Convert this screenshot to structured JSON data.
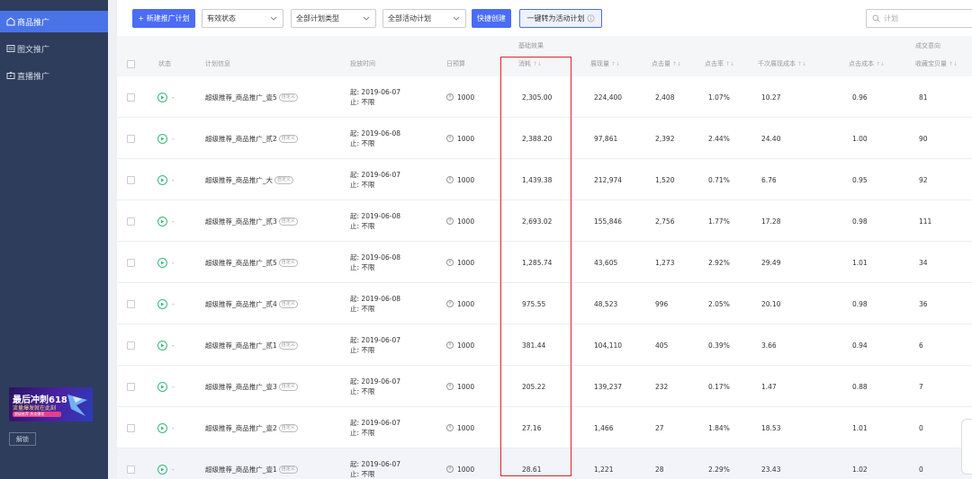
{
  "sidebar": {
    "items": [
      {
        "label": "商品推广",
        "icon": "bag-icon",
        "active": true
      },
      {
        "label": "图文推广",
        "icon": "image-icon",
        "active": false
      },
      {
        "label": "直播推广",
        "icon": "tv-icon",
        "active": false
      }
    ],
    "banner": {
      "title": "最后冲刺618",
      "subtitle": "流量爆发就在此刻",
      "tag": "超级推荐 热卖爆发"
    },
    "unlock_label": "解锁"
  },
  "toolbar": {
    "new_plan_label": "+ 新建推广计划",
    "status_select": "有效状态",
    "type_select": "全部计划类型",
    "activity_select": "全部活动计划",
    "quick_create_label": "快捷创建",
    "convert_label": "一键转为活动计划",
    "search_placeholder": "计划"
  },
  "table": {
    "groups": {
      "basic": "基础效果",
      "conversion": "成交意向"
    },
    "headers": {
      "status": "状态",
      "plan_info": "计划信息",
      "time": "投放时间",
      "budget": "日预算",
      "cost": "消耗",
      "impressions": "展现量",
      "clicks": "点击量",
      "ctr": "点击率",
      "cpm": "千次展现成本",
      "cpc": "点击成本",
      "fav": "收藏宝贝量"
    },
    "sort_glyph": "↑↓",
    "tag_label": "自定义",
    "start_prefix": "起: ",
    "end_label": "止: 不限",
    "status_dash": "-",
    "coin_glyph": "¥",
    "rows": [
      {
        "name": "超级推荐_商品推广_壹5",
        "start": "2019-06-07",
        "budget": "1000",
        "cost": "2,305.00",
        "impressions": "224,400",
        "clicks": "2,408",
        "ctr": "1.07%",
        "cpm": "10.27",
        "cpc": "0.96",
        "fav": "81"
      },
      {
        "name": "超级推荐_商品推广_贰2",
        "start": "2019-06-08",
        "budget": "1000",
        "cost": "2,388.20",
        "impressions": "97,861",
        "clicks": "2,392",
        "ctr": "2.44%",
        "cpm": "24.40",
        "cpc": "1.00",
        "fav": "90"
      },
      {
        "name": "超级推荐_商品推广_大",
        "start": "2019-06-07",
        "budget": "1000",
        "cost": "1,439.38",
        "impressions": "212,974",
        "clicks": "1,520",
        "ctr": "0.71%",
        "cpm": "6.76",
        "cpc": "0.95",
        "fav": "92"
      },
      {
        "name": "超级推荐_商品推广_贰3",
        "start": "2019-06-08",
        "budget": "1000",
        "cost": "2,693.02",
        "impressions": "155,846",
        "clicks": "2,756",
        "ctr": "1.77%",
        "cpm": "17.28",
        "cpc": "0.98",
        "fav": "111"
      },
      {
        "name": "超级推荐_商品推广_贰5",
        "start": "2019-06-08",
        "budget": "1000",
        "cost": "1,285.74",
        "impressions": "43,605",
        "clicks": "1,273",
        "ctr": "2.92%",
        "cpm": "29.49",
        "cpc": "1.01",
        "fav": "34"
      },
      {
        "name": "超级推荐_商品推广_贰4",
        "start": "2019-06-08",
        "budget": "1000",
        "cost": "975.55",
        "impressions": "48,523",
        "clicks": "996",
        "ctr": "2.05%",
        "cpm": "20.10",
        "cpc": "0.98",
        "fav": "36"
      },
      {
        "name": "超级推荐_商品推广_贰1",
        "start": "2019-06-07",
        "budget": "1000",
        "cost": "381.44",
        "impressions": "104,110",
        "clicks": "405",
        "ctr": "0.39%",
        "cpm": "3.66",
        "cpc": "0.94",
        "fav": "6"
      },
      {
        "name": "超级推荐_商品推广_壹3",
        "start": "2019-06-07",
        "budget": "1000",
        "cost": "205.22",
        "impressions": "139,237",
        "clicks": "232",
        "ctr": "0.17%",
        "cpm": "1.47",
        "cpc": "0.88",
        "fav": "7"
      },
      {
        "name": "超级推荐_商品推广_壹2",
        "start": "2019-06-07",
        "budget": "1000",
        "cost": "27.16",
        "impressions": "1,466",
        "clicks": "27",
        "ctr": "1.84%",
        "cpm": "18.53",
        "cpc": "1.01",
        "fav": "0"
      },
      {
        "name": "超级推荐_商品推广_壹1",
        "start": "2019-06-07",
        "budget": "1000",
        "cost": "28.61",
        "impressions": "1,221",
        "clicks": "28",
        "ctr": "2.29%",
        "cpm": "23.43",
        "cpc": "1.02",
        "fav": "0"
      }
    ]
  },
  "colors": {
    "accent": "#4a6cf7",
    "sidebar_bg": "#2f3d5c",
    "highlight_frame": "#e0242b",
    "status_green": "#3cb878"
  }
}
